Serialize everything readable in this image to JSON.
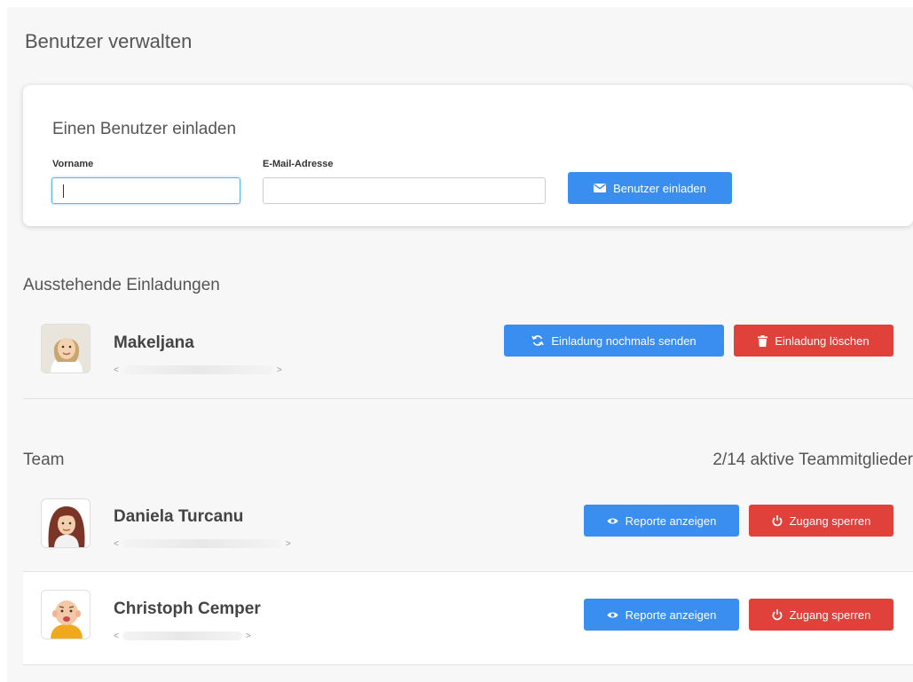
{
  "page": {
    "title": "Benutzer verwalten"
  },
  "invite": {
    "title": "Einen Benutzer einladen",
    "firstname_label": "Vorname",
    "firstname_value": "",
    "email_label": "E-Mail-Adresse",
    "email_value": "",
    "submit_label": "Benutzer einladen",
    "submit_icon": "envelope-icon"
  },
  "pending": {
    "title": "Ausstehende Einladungen",
    "items": [
      {
        "name": "Makeljana",
        "email_open": "<",
        "email_close": ">",
        "resend_label": "Einladung nochmals senden",
        "delete_label": "Einladung löschen"
      }
    ]
  },
  "team": {
    "title": "Team",
    "count_text": "2/14 aktive Teammitglieder",
    "members": [
      {
        "name": "Daniela Turcanu",
        "email_open": "<",
        "email_close": ">",
        "reports_label": "Reporte anzeigen",
        "block_label": "Zugang sperren"
      },
      {
        "name": "Christoph Cemper",
        "email_open": "<",
        "email_close": ">",
        "reports_label": "Reporte anzeigen",
        "block_label": "Zugang sperren"
      }
    ]
  },
  "colors": {
    "primary": "#3a8ef0",
    "danger": "#e0413b",
    "background": "#f7f7f7"
  }
}
